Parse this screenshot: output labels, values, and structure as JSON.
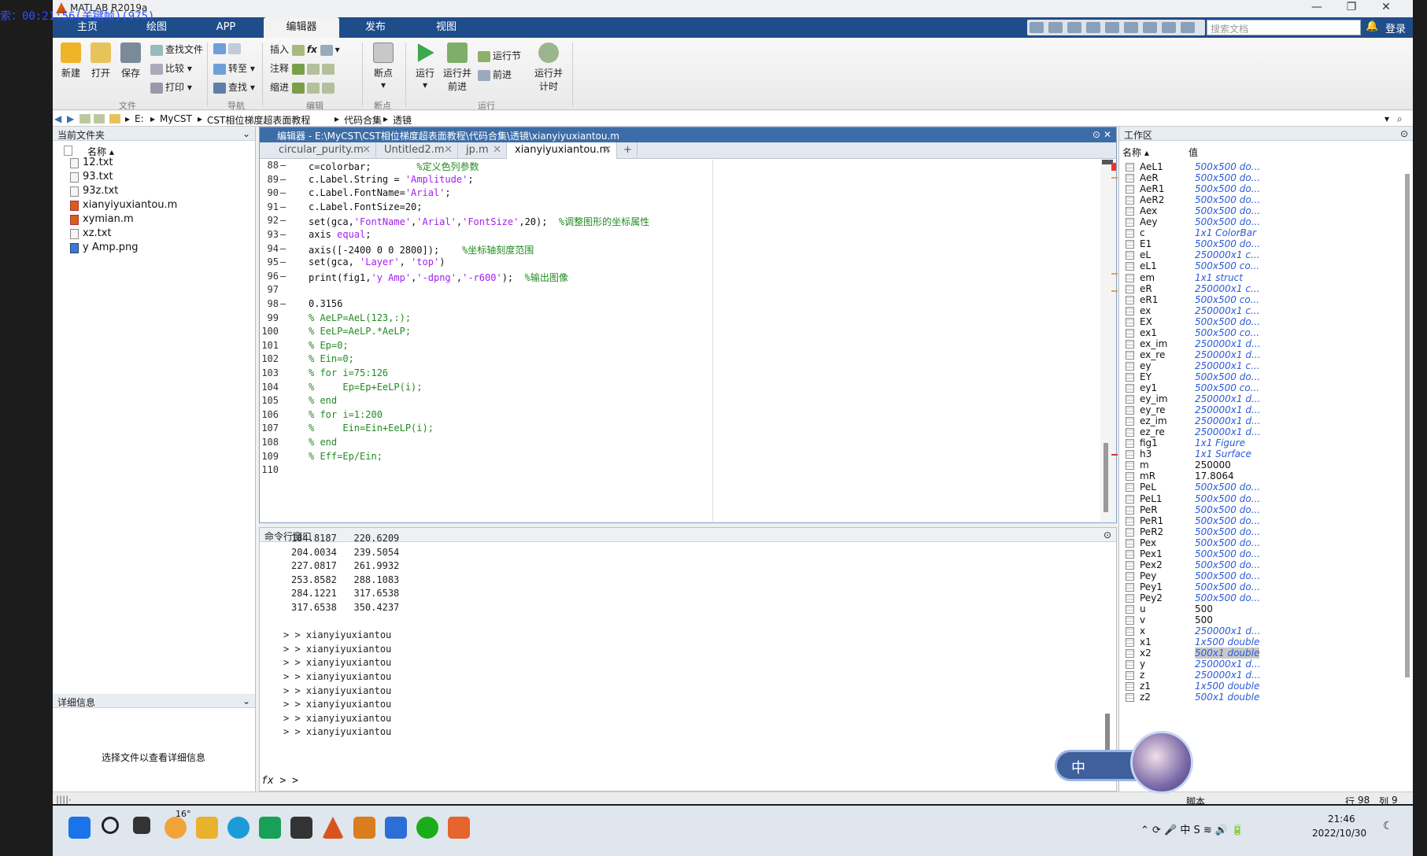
{
  "recording_overlay": "索：00:21:56(关键帧)(975)",
  "window": {
    "title": "MATLAB R2019a",
    "controls": [
      "—",
      "❐",
      "✕"
    ]
  },
  "ribbon_tabs": [
    "主页",
    "绘图",
    "APP",
    "编辑器",
    "发布",
    "视图"
  ],
  "active_tab": "编辑器",
  "search": {
    "placeholder": "搜索文档"
  },
  "login_label": "登录",
  "ribbon": {
    "file": {
      "new": "新建",
      "open": "打开",
      "save": "保存",
      "find_files": "查找文件",
      "compare": "比较",
      "print": "打印",
      "group": "文件"
    },
    "nav": {
      "goto": "转至",
      "find": "查找",
      "group": "导航"
    },
    "edit": {
      "insert": "插入",
      "comment": "注释",
      "indent": "缩进",
      "group": "编辑"
    },
    "breakpoints": {
      "label": "断点",
      "group": "断点"
    },
    "run": {
      "run": "运行",
      "run_advance": "运行并\n前进",
      "run_section": "运行节",
      "advance": "前进",
      "run_time": "运行并\n计时",
      "group": "运行"
    }
  },
  "address": [
    "E:",
    "MyCST",
    "CST相位梯度超表面教程",
    "代码合集",
    "透镜"
  ],
  "current_folder": {
    "title": "当前文件夹",
    "col_name": "名称 ▴",
    "files": [
      {
        "name": "12.txt",
        "type": "txt"
      },
      {
        "name": "93.txt",
        "type": "txt"
      },
      {
        "name": "93z.txt",
        "type": "txt"
      },
      {
        "name": "xianyiyuxiantou.m",
        "type": "m"
      },
      {
        "name": "xymian.m",
        "type": "m"
      },
      {
        "name": "xz.txt",
        "type": "txt"
      },
      {
        "name": "y Amp.png",
        "type": "png"
      }
    ]
  },
  "details": {
    "title": "详细信息",
    "hint": "选择文件以查看详细信息"
  },
  "editor": {
    "title": "编辑器 - E:\\MyCST\\CST相位梯度超表面教程\\代码合集\\透镜\\xianyiyuxiantou.m",
    "tabs": [
      "circular_purity.m",
      "Untitled2.m",
      "jp.m",
      "xianyiyuxiantou.m"
    ],
    "active_tab": "xianyiyuxiantou.m",
    "lines": [
      {
        "n": "88",
        "dash": "—",
        "code": "c=colorbar;        %定义色列参数"
      },
      {
        "n": "89",
        "dash": "—",
        "code": "c.Label.String = 'Amplitude';"
      },
      {
        "n": "90",
        "dash": "—",
        "code": "c.Label.FontName='Arial';"
      },
      {
        "n": "91",
        "dash": "—",
        "code": "c.Label.FontSize=20;"
      },
      {
        "n": "92",
        "dash": "—",
        "code": "set(gca,'FontName','Arial','FontSize',20);  %调整图形的坐标属性"
      },
      {
        "n": "93",
        "dash": "—",
        "code": "axis equal;"
      },
      {
        "n": "94",
        "dash": "—",
        "code": "axis([-2400 0 0 2800]);    %坐标轴刻度范围"
      },
      {
        "n": "95",
        "dash": "—",
        "code": "set(gca, 'Layer', 'top')"
      },
      {
        "n": "96",
        "dash": "—",
        "code": "print(fig1,'y Amp','-dpng','-r600');  %输出图像"
      },
      {
        "n": "97",
        "dash": "",
        "code": ""
      },
      {
        "n": "98",
        "dash": "—",
        "code": "0.3156"
      },
      {
        "n": "99",
        "dash": "",
        "code": "% AeLP=AeL(123,:);"
      },
      {
        "n": "100",
        "dash": "",
        "code": "% EeLP=AeLP.*AeLP;"
      },
      {
        "n": "101",
        "dash": "",
        "code": "% Ep=0;"
      },
      {
        "n": "102",
        "dash": "",
        "code": "% Ein=0;"
      },
      {
        "n": "103",
        "dash": "",
        "code": "% for i=75:126"
      },
      {
        "n": "104",
        "dash": "",
        "code": "%     Ep=Ep+EeLP(i);"
      },
      {
        "n": "105",
        "dash": "",
        "code": "% end"
      },
      {
        "n": "106",
        "dash": "",
        "code": "% for i=1:200"
      },
      {
        "n": "107",
        "dash": "",
        "code": "%     Ein=Ein+EeLP(i);"
      },
      {
        "n": "108",
        "dash": "",
        "code": "% end"
      },
      {
        "n": "109",
        "dash": "",
        "code": "% Eff=Ep/Ein;"
      },
      {
        "n": "110",
        "dash": "",
        "code": ""
      }
    ]
  },
  "command_window": {
    "title": "命令行窗口",
    "lines": [
      "184.8187   220.6209",
      "204.0034   239.5054",
      "227.0817   261.9932",
      "253.8582   288.1083",
      "284.1221   317.6538",
      "317.6538   350.4237",
      "",
      "> > xianyiyuxiantou",
      "> > xianyiyuxiantou",
      "> > xianyiyuxiantou",
      "> > xianyiyuxiantou",
      "> > xianyiyuxiantou",
      "> > xianyiyuxiantou",
      "> > xianyiyuxiantou",
      "> > xianyiyuxiantou"
    ],
    "prompt": "fx > >"
  },
  "workspace": {
    "title": "工作区",
    "col_name": "名称 ▴",
    "col_value": "值",
    "vars": [
      [
        "AeL1",
        "500x500 do..."
      ],
      [
        "AeR",
        "500x500 do..."
      ],
      [
        "AeR1",
        "500x500 do..."
      ],
      [
        "AeR2",
        "500x500 do..."
      ],
      [
        "Aex",
        "500x500 do..."
      ],
      [
        "Aey",
        "500x500 do..."
      ],
      [
        "c",
        "1x1 ColorBar"
      ],
      [
        "E1",
        "500x500 do..."
      ],
      [
        "eL",
        "250000x1 c..."
      ],
      [
        "eL1",
        "500x500 co..."
      ],
      [
        "em",
        "1x1 struct"
      ],
      [
        "eR",
        "250000x1 c..."
      ],
      [
        "eR1",
        "500x500 co..."
      ],
      [
        "ex",
        "250000x1 c..."
      ],
      [
        "EX",
        "500x500 do..."
      ],
      [
        "ex1",
        "500x500 co..."
      ],
      [
        "ex_im",
        "250000x1 d..."
      ],
      [
        "ex_re",
        "250000x1 d..."
      ],
      [
        "ey",
        "250000x1 c..."
      ],
      [
        "EY",
        "500x500 do..."
      ],
      [
        "ey1",
        "500x500 co..."
      ],
      [
        "ey_im",
        "250000x1 d..."
      ],
      [
        "ey_re",
        "250000x1 d..."
      ],
      [
        "ez_im",
        "250000x1 d..."
      ],
      [
        "ez_re",
        "250000x1 d..."
      ],
      [
        "fig1",
        "1x1 Figure"
      ],
      [
        "h3",
        "1x1 Surface"
      ],
      [
        "m",
        "250000"
      ],
      [
        "mR",
        "17.8064"
      ],
      [
        "PeL",
        "500x500 do..."
      ],
      [
        "PeL1",
        "500x500 do..."
      ],
      [
        "PeR",
        "500x500 do..."
      ],
      [
        "PeR1",
        "500x500 do..."
      ],
      [
        "PeR2",
        "500x500 do..."
      ],
      [
        "Pex",
        "500x500 do..."
      ],
      [
        "Pex1",
        "500x500 do..."
      ],
      [
        "Pex2",
        "500x500 do..."
      ],
      [
        "Pey",
        "500x500 do..."
      ],
      [
        "Pey1",
        "500x500 do..."
      ],
      [
        "Pey2",
        "500x500 do..."
      ],
      [
        "u",
        "500"
      ],
      [
        "v",
        "500"
      ],
      [
        "x",
        "250000x1 d..."
      ],
      [
        "x1",
        "1x500 double"
      ],
      [
        "x2",
        "500x1 double"
      ],
      [
        "y",
        "250000x1 d..."
      ],
      [
        "z",
        "250000x1 d..."
      ],
      [
        "z1",
        "1x500 double"
      ],
      [
        "z2",
        "500x1 double"
      ]
    ]
  },
  "status": {
    "mode": "脚本",
    "row_label": "行",
    "row": "98",
    "col_label": "列",
    "col": "9"
  },
  "taskbar": {
    "weather": "16°",
    "time": "21:46",
    "date": "2022/10/30",
    "ime": "中"
  }
}
